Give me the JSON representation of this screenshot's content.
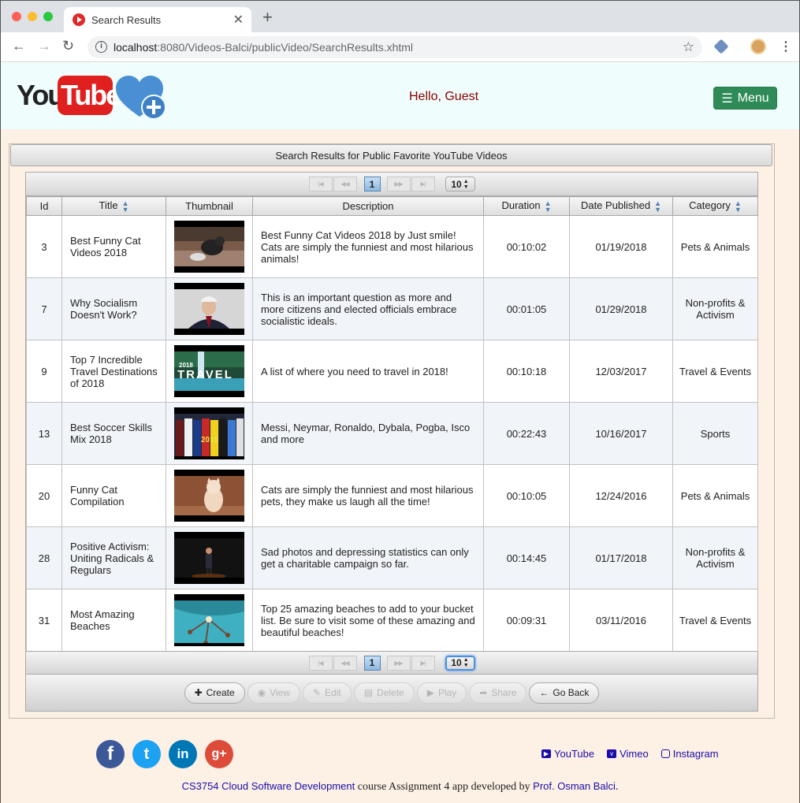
{
  "browser": {
    "tab_title": "Search Results",
    "tab_close": "✕",
    "new_tab": "+",
    "url_host": "localhost",
    "url_rest": ":8080/Videos-Balci/publicVideo/SearchResults.xhtml"
  },
  "header": {
    "greeting": "Hello, Guest",
    "menu_label": "Menu",
    "logo_you": "You",
    "logo_tube": "Tube"
  },
  "panel": {
    "title": "Search Results for Public Favorite YouTube Videos"
  },
  "paginator": {
    "first": "|◀",
    "prev": "◀◀",
    "current_page": "1",
    "next": "▶▶",
    "last": "▶|",
    "rows_per_page": "10"
  },
  "columns": [
    "Id",
    "Title",
    "Thumbnail",
    "Description",
    "Duration",
    "Date Published",
    "Category"
  ],
  "rows": [
    {
      "id": "3",
      "title": "Best Funny Cat Videos 2018",
      "description": "Best Funny Cat Videos 2018 by Just smile! Cats are simply the funniest and most hilarious animals!",
      "duration": "00:10:02",
      "date": "01/19/2018",
      "category": "Pets & Animals",
      "thumb": "cat-on-floor",
      "thumb_color": "#6b5040"
    },
    {
      "id": "7",
      "title": "Why Socialism Doesn't Work?",
      "description": "This is an important question as more and more citizens and elected officials embrace socialistic ideals.",
      "duration": "00:01:05",
      "date": "01/29/2018",
      "category": "Non-profits & Activism",
      "thumb": "man-speaking",
      "thumb_color": "#c8c8c8"
    },
    {
      "id": "9",
      "title": "Top 7 Incredible Travel Destinations of 2018",
      "description": "A list of where you need to travel in 2018!",
      "duration": "00:10:18",
      "date": "12/03/2017",
      "category": "Travel & Events",
      "thumb": "travel-title",
      "thumb_color": "#3a8aa0"
    },
    {
      "id": "13",
      "title": "Best Soccer Skills Mix 2018",
      "description": "Messi, Neymar, Ronaldo, Dybala, Pogba, Isco and more",
      "duration": "00:22:43",
      "date": "10/16/2017",
      "category": "Sports",
      "thumb": "soccer-players",
      "thumb_color": "#283048"
    },
    {
      "id": "20",
      "title": "Funny Cat Compilation",
      "description": "Cats are simply the funniest and most hilarious pets, they make us laugh all the time!",
      "duration": "00:10:05",
      "date": "12/24/2016",
      "category": "Pets & Animals",
      "thumb": "kitten",
      "thumb_color": "#8a5034"
    },
    {
      "id": "28",
      "title": "Positive Activism: Uniting Radicals & Regulars",
      "description": "Sad photos and depressing statistics can only get a charitable campaign so far.",
      "duration": "00:14:45",
      "date": "01/17/2018",
      "category": "Non-profits & Activism",
      "thumb": "stage-speaker",
      "thumb_color": "#151515"
    },
    {
      "id": "31",
      "title": "Most Amazing Beaches",
      "description": "Top 25 amazing beaches to add to your bucket list. Be sure to visit some of these amazing and beautiful beaches!",
      "duration": "00:09:31",
      "date": "03/11/2016",
      "category": "Travel & Events",
      "thumb": "beach-aerial",
      "thumb_color": "#48b8c0"
    }
  ],
  "thumb_text": {
    "travel_year": "2018",
    "travel_word": "TRAVEL",
    "soccer_year": "2018"
  },
  "actions": {
    "create": "Create",
    "view": "View",
    "edit": "Edit",
    "delete": "Delete",
    "play": "Play",
    "share": "Share",
    "go_back": "Go Back"
  },
  "social": {
    "facebook": "f",
    "twitter": "t",
    "linkedin": "in",
    "googleplus": "g+"
  },
  "links": {
    "youtube": "YouTube",
    "vimeo": "Vimeo",
    "instagram": "Instagram"
  },
  "footer": {
    "course": "CS3754 Cloud Software Development",
    "middle": " course Assignment 4 app developed by ",
    "author": "Prof. Osman Balci",
    "end": "."
  },
  "colors": {
    "header_bg": "#effdfd",
    "content_bg": "#fdf0e4",
    "menu_green": "#2e8b57",
    "greeting_red": "#8b0000",
    "link_blue": "#1a0dab"
  }
}
